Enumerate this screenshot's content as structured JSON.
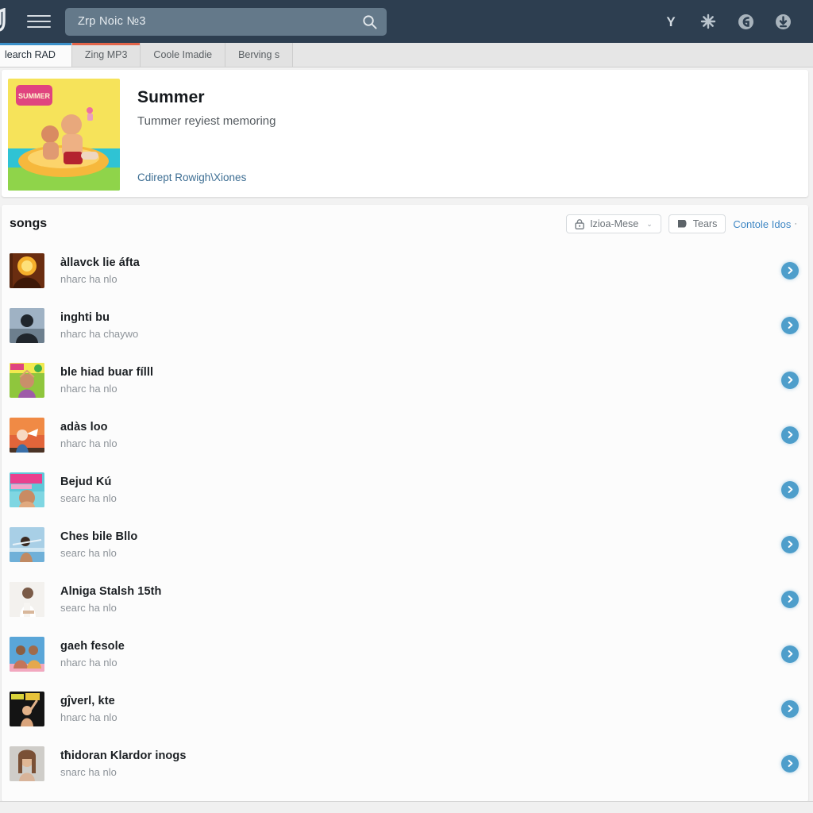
{
  "header": {
    "logo_icon": "music-note-logo",
    "menu_icon": "hamburger-menu-icon",
    "search_value": "Zrp Noic №3",
    "search_placeholder": "Zrp Noic №3",
    "search_icon": "search-icon",
    "icons": [
      {
        "name": "y-brand-icon",
        "glyph": "Y"
      },
      {
        "name": "gear-icon",
        "glyph": "✸"
      },
      {
        "name": "compass-circle-icon",
        "glyph": "◉"
      },
      {
        "name": "download-circle-icon",
        "glyph": "⬇"
      }
    ],
    "bg_color": "#2d3e50",
    "search_bg_color": "#64798a"
  },
  "tabs": [
    {
      "label": "learch RAD",
      "active": true,
      "accent": "#3b90c9"
    },
    {
      "label": "Zing MP3",
      "active": false,
      "accent": "#e2654a"
    },
    {
      "label": "Coole Imadie",
      "active": false,
      "accent": ""
    },
    {
      "label": "Berving s",
      "active": false,
      "accent": ""
    }
  ],
  "banner": {
    "artwork_name": "summer-cover-artwork",
    "title": "Summer",
    "subtitle": "Tummer reyiest memoring",
    "link": "Cdirept Rowigh\\Xiones",
    "link_color": "#3d6e93"
  },
  "songs_section": {
    "heading": "songs",
    "dropdown": {
      "icon": "lock-icon",
      "label": "Izioa-Mese",
      "caret": "⌄"
    },
    "filter_button": {
      "icon": "tag-icon",
      "label": "Tears"
    },
    "link": {
      "label": "Contole Idos",
      "dot": "·",
      "color": "#3f87c4"
    }
  },
  "songs": [
    {
      "title": "àllavck lie áfta",
      "subtitle": "nharc ha nlo",
      "art": "art-sun-orange",
      "action_icon": "chevron-right-icon"
    },
    {
      "title": "inghti bu",
      "subtitle": "nharc ha chaywo",
      "art": "art-silhouette",
      "action_icon": "chevron-right-icon"
    },
    {
      "title": "ble hiad buar fílll",
      "subtitle": "nharc ha nlo",
      "art": "art-green-yellow",
      "action_icon": "chevron-right-icon"
    },
    {
      "title": "adàs loo",
      "subtitle": "nharc ha nlo",
      "art": "art-orange-sky",
      "action_icon": "chevron-right-icon"
    },
    {
      "title": "Bejud Kú",
      "subtitle": "searc ha nlo",
      "art": "art-beach-pink",
      "action_icon": "chevron-right-icon"
    },
    {
      "title": "Ches bile Bllo",
      "subtitle": "searc ha nlo",
      "art": "art-blue-sky",
      "action_icon": "chevron-right-icon"
    },
    {
      "title": "Alniga Stalsh 15th",
      "subtitle": "searc ha nlo",
      "art": "art-white-studio",
      "action_icon": "chevron-right-icon"
    },
    {
      "title": "gaeh fesole",
      "subtitle": "nharc ha nlo",
      "art": "art-duo-blue",
      "action_icon": "chevron-right-icon"
    },
    {
      "title": "gĵverl, ktе",
      "subtitle": "hnarc ha nlo",
      "art": "art-dark-stage",
      "action_icon": "chevron-right-icon"
    },
    {
      "title": "tħidoran Klardor inogs",
      "subtitle": "snarc ha nlo",
      "art": "art-portrait-gray",
      "action_icon": "chevron-right-icon"
    }
  ]
}
